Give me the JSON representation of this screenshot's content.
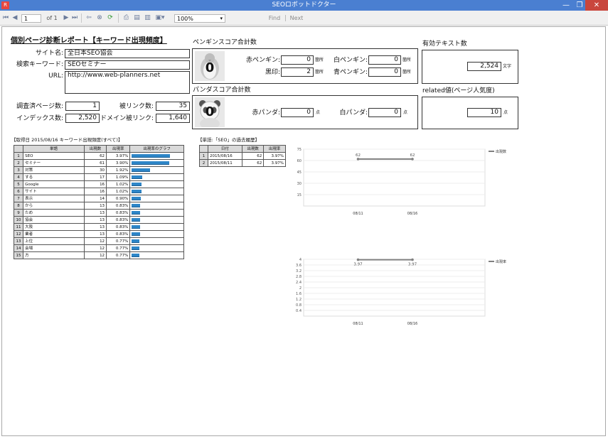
{
  "window": {
    "title": "SEOロボットドクター",
    "app_icon": "app-icon",
    "minimize": "—",
    "maximize": "❐",
    "close": "✕"
  },
  "toolbar": {
    "page_current": "1",
    "page_of": "of 1",
    "zoom": "100%",
    "find_label": "Find",
    "next_label": "Next"
  },
  "report": {
    "title": "個別ページ診断レポート【キーワード出現頻度】",
    "site_name_label": "サイト名:",
    "site_name": "全日本SEO協会",
    "keyword_label": "検索キーワード:",
    "keyword": "SEOセミナー",
    "url_label": "URL:",
    "url": "http://www.web-planners.net",
    "surveyed_pages_label": "調査済ページ数:",
    "surveyed_pages": "1",
    "backlinks_label": "被リンク数:",
    "backlinks": "35",
    "indexed_label": "インデックス数:",
    "indexed": "2,520",
    "domain_backlinks_label": "ドメイン被リンク:",
    "domain_backlinks": "1,640"
  },
  "penguin": {
    "title": "ペンギンスコア合計数",
    "total": "0",
    "red_label": "赤ペンギン:",
    "red": "0",
    "white_label": "白ペンギン:",
    "white": "0",
    "black_label": "黒印:",
    "black": "2",
    "blue_label": "青ペンギン:",
    "blue": "0",
    "unit": "箇所"
  },
  "panda": {
    "title": "パンダスコア合計数",
    "total": "0",
    "red_label": "赤パンダ:",
    "red": "0",
    "white_label": "白パンダ:",
    "white": "0",
    "unit": "点"
  },
  "valid_text": {
    "title": "有効テキスト数",
    "value": "2,524",
    "unit": "文字"
  },
  "related": {
    "title": "related値(ページ人気度)",
    "value": "10",
    "unit": "点"
  },
  "freq_table": {
    "title": "【取得日 2015/08/16 キーワード出現頻度(すべて)】",
    "headers": [
      "単語",
      "出現数",
      "出現率",
      "出現率のグラフ"
    ],
    "rows": [
      {
        "i": "1",
        "word": "SEO",
        "count": "62",
        "rate": "3.97%",
        "pct": 3.97
      },
      {
        "i": "2",
        "word": "セミナー",
        "count": "61",
        "rate": "3.90%",
        "pct": 3.9
      },
      {
        "i": "3",
        "word": "対策",
        "count": "30",
        "rate": "1.92%",
        "pct": 1.92
      },
      {
        "i": "4",
        "word": "する",
        "count": "17",
        "rate": "1.09%",
        "pct": 1.09
      },
      {
        "i": "5",
        "word": "Google",
        "count": "16",
        "rate": "1.02%",
        "pct": 1.02
      },
      {
        "i": "6",
        "word": "サイト",
        "count": "16",
        "rate": "1.02%",
        "pct": 1.02
      },
      {
        "i": "7",
        "word": "表示",
        "count": "14",
        "rate": "0.90%",
        "pct": 0.9
      },
      {
        "i": "8",
        "word": "から",
        "count": "13",
        "rate": "0.83%",
        "pct": 0.83
      },
      {
        "i": "9",
        "word": "ため",
        "count": "13",
        "rate": "0.83%",
        "pct": 0.83
      },
      {
        "i": "10",
        "word": "協会",
        "count": "13",
        "rate": "0.83%",
        "pct": 0.83
      },
      {
        "i": "11",
        "word": "大阪",
        "count": "13",
        "rate": "0.83%",
        "pct": 0.83
      },
      {
        "i": "12",
        "word": "業者",
        "count": "13",
        "rate": "0.83%",
        "pct": 0.83
      },
      {
        "i": "13",
        "word": "上位",
        "count": "12",
        "rate": "0.77%",
        "pct": 0.77
      },
      {
        "i": "14",
        "word": "会場",
        "count": "12",
        "rate": "0.77%",
        "pct": 0.77
      },
      {
        "i": "15",
        "word": "方",
        "count": "12",
        "rate": "0.77%",
        "pct": 0.77
      }
    ]
  },
  "history_table": {
    "title": "【単語:「SEO」の過去履歴】",
    "headers": [
      "日付",
      "出現数",
      "出現率"
    ],
    "rows": [
      {
        "i": "1",
        "date": "2015/08/16",
        "count": "62",
        "rate": "3.97%"
      },
      {
        "i": "2",
        "date": "2015/08/11",
        "count": "62",
        "rate": "3.97%"
      }
    ]
  },
  "chart_data": [
    {
      "type": "line",
      "categories": [
        "08/11",
        "08/16"
      ],
      "series": [
        {
          "name": "出現数",
          "values": [
            62,
            62
          ]
        }
      ],
      "data_labels": [
        "62",
        "62"
      ],
      "y_ticks": [
        "75",
        "60",
        "45",
        "30",
        "15"
      ],
      "ylim": [
        0,
        75
      ],
      "color": "#808080",
      "legend": "right"
    },
    {
      "type": "line",
      "categories": [
        "08/11",
        "08/16"
      ],
      "series": [
        {
          "name": "出現率",
          "values": [
            3.97,
            3.97
          ]
        }
      ],
      "data_labels": [
        "3.97",
        "3.97"
      ],
      "y_ticks": [
        "4",
        "3.6",
        "3.2",
        "2.8",
        "2.4",
        "2",
        "1.6",
        "1.2",
        "0.8",
        "0.4"
      ],
      "ylim": [
        0,
        4
      ],
      "color": "#808080",
      "legend": "right"
    }
  ]
}
